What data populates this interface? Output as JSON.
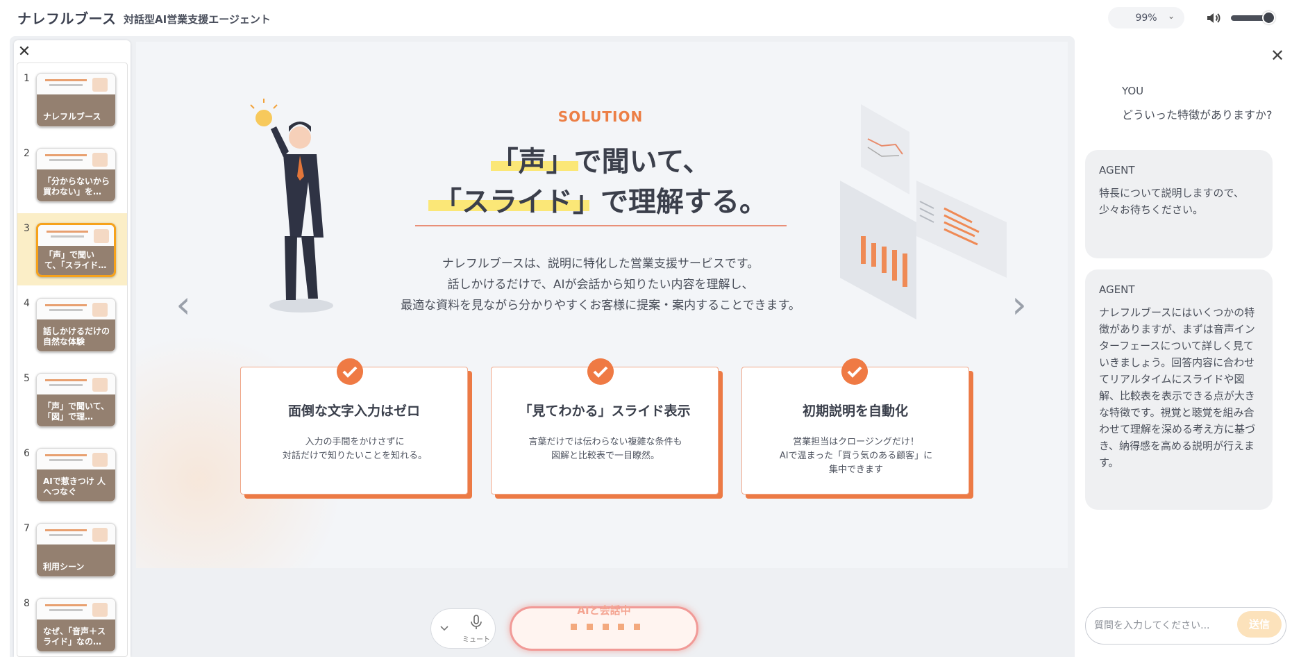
{
  "header": {
    "app_title": "ナレフルブース",
    "app_subtitle": "対話型AI営業支援エージェント",
    "zoom": "99%",
    "volume_level": 0.85
  },
  "sidebar": {
    "close_icon": "close-icon",
    "active_index": 3,
    "thumbnails": [
      {
        "num": "1",
        "label": "ナレフルブース"
      },
      {
        "num": "2",
        "label": "「分からないから買わない」を…"
      },
      {
        "num": "3",
        "label": "「声」で聞いて、「スライド…"
      },
      {
        "num": "4",
        "label": "話しかけるだけの自然な体験"
      },
      {
        "num": "5",
        "label": "「声」で聞いて、「図」で理…"
      },
      {
        "num": "6",
        "label": "AIで惹きつけ 人へつなぐ"
      },
      {
        "num": "7",
        "label": "利用シーン"
      },
      {
        "num": "8",
        "label": "なぜ、「音声＋スライド」なの…"
      }
    ]
  },
  "slide": {
    "section_label": "SOLUTION",
    "headline_line1": "「声」で聞いて、",
    "headline_line2": "「スライド」で理解する。",
    "description": [
      "ナレフルブースは、説明に特化した営業支援サービスです。",
      "話しかけるだけで、AIが会話から知りたい内容を理解し、",
      "最適な資料を見ながら分かりやすくお客様に提案・案内することできます。"
    ],
    "cards": [
      {
        "title": "面倒な文字入力はゼロ",
        "desc": "入力の手間をかけさずに\n対話だけで知りたいことを知れる。"
      },
      {
        "title": "「見てわかる」スライド表示",
        "desc": "言葉だけでは伝わらない複雑な条件も\n図解と比較表で一目瞭然。"
      },
      {
        "title": "初期説明を自動化",
        "desc": "営業担当はクロージングだけ！\nAIで温まった「買う気のある顧客」に\n集中できます"
      }
    ],
    "accent_color": "#ec7a45"
  },
  "controls": {
    "mic_label": "ミュート",
    "talk_label": "AIと会話中"
  },
  "chat": {
    "you_label": "YOU",
    "you_text": "どういった特徴がありますか?",
    "messages": [
      {
        "label": "AGENT",
        "text": "特長について説明しますので、少々お待ちください。"
      },
      {
        "label": "AGENT",
        "text": "ナレフルブースにはいくつかの特徴がありますが、まずは音声インターフェースについて詳しく見ていきましょう。回答内容に合わせてリアルタイムにスライドや図解、比較表を表示できる点が大きな特徴です。視覚と聴覚を組み合わせて理解を深める考え方に基づき、納得感を高める説明が行えます。"
      }
    ],
    "input_placeholder": "質問を入力してください...",
    "send_label": "送信"
  }
}
